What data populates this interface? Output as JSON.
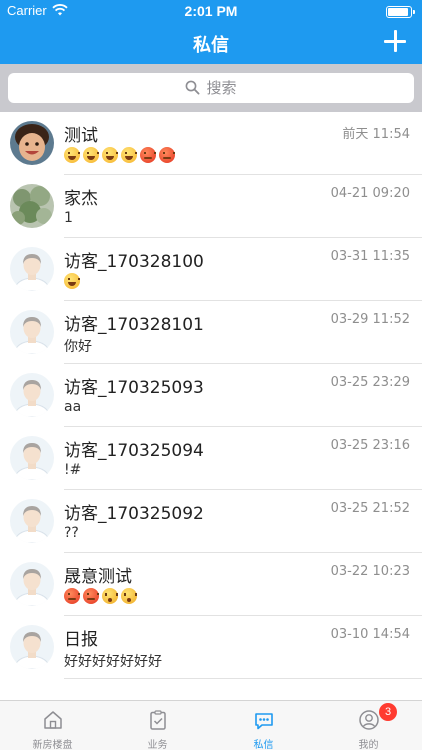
{
  "status_bar": {
    "carrier": "Carrier",
    "time": "2:01 PM"
  },
  "nav": {
    "title": "私信"
  },
  "search": {
    "placeholder": "搜索"
  },
  "colors": {
    "accent": "#1E9AF0",
    "badge": "#FF3B30",
    "search_bg": "#C9C9CE"
  },
  "conversations": [
    {
      "name": "测试",
      "time": "前天 11:54",
      "message": "",
      "emojis": [
        "laugh",
        "laugh",
        "laugh",
        "laugh",
        "angry",
        "angry"
      ],
      "avatar": "child-photo"
    },
    {
      "name": "家杰",
      "time": "04-21 09:20",
      "message": "1",
      "emojis": [],
      "avatar": "plant-photo"
    },
    {
      "name": "访客_170328100",
      "time": "03-31 11:35",
      "message": "",
      "emojis": [
        "laugh"
      ],
      "avatar": "default"
    },
    {
      "name": "访客_170328101",
      "time": "03-29 11:52",
      "message": "你好",
      "emojis": [],
      "avatar": "default"
    },
    {
      "name": "访客_170325093",
      "time": "03-25 23:29",
      "message": "aa",
      "emojis": [],
      "avatar": "default"
    },
    {
      "name": "访客_170325094",
      "time": "03-25 23:16",
      "message": "!#",
      "emojis": [],
      "avatar": "default"
    },
    {
      "name": "访客_170325092",
      "time": "03-25 21:52",
      "message": "??",
      "emojis": [],
      "avatar": "default"
    },
    {
      "name": "晟意测试",
      "time": "03-22 10:23",
      "message": "",
      "emojis": [
        "angry",
        "angry",
        "dizzy",
        "dizzy"
      ],
      "avatar": "default"
    },
    {
      "name": "日报",
      "time": "03-10 14:54",
      "message": "好好好好好好好",
      "emojis": [],
      "avatar": "default"
    }
  ],
  "tabs": [
    {
      "label": "新房楼盘",
      "icon": "home-icon"
    },
    {
      "label": "业务",
      "icon": "clipboard-icon"
    },
    {
      "label": "私信",
      "icon": "message-icon",
      "active": true
    },
    {
      "label": "我的",
      "icon": "user-icon",
      "badge": "3"
    }
  ]
}
